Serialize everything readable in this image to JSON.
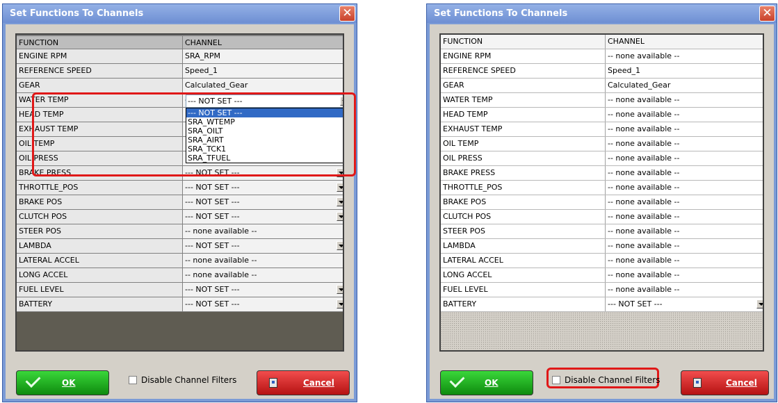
{
  "dialog_left": {
    "title": "Set Functions To Channels",
    "header": {
      "function": "FUNCTION",
      "channel": "CHANNEL"
    },
    "rows": [
      {
        "function": "ENGINE RPM",
        "channel": "SRA_RPM",
        "dropdown": false
      },
      {
        "function": "REFERENCE SPEED",
        "channel": "Speed_1",
        "dropdown": false
      },
      {
        "function": "GEAR",
        "channel": "Calculated_Gear",
        "dropdown": false
      },
      {
        "function": "WATER TEMP",
        "channel": "--- NOT SET ---",
        "dropdown": true
      },
      {
        "function": "HEAD TEMP",
        "channel": "",
        "dropdown": false
      },
      {
        "function": "EXHAUST TEMP",
        "channel": "",
        "dropdown": false
      },
      {
        "function": "OIL TEMP",
        "channel": "",
        "dropdown": false
      },
      {
        "function": "OIL  PRESS",
        "channel": "",
        "dropdown": false
      },
      {
        "function": "BRAKE PRESS",
        "channel": "--- NOT SET ---",
        "dropdown": true
      },
      {
        "function": "THROTTLE_POS",
        "channel": "--- NOT SET ---",
        "dropdown": true
      },
      {
        "function": "BRAKE POS",
        "channel": "--- NOT SET ---",
        "dropdown": true
      },
      {
        "function": "CLUTCH POS",
        "channel": "--- NOT SET ---",
        "dropdown": true
      },
      {
        "function": "STEER POS",
        "channel": "-- none available --",
        "dropdown": false
      },
      {
        "function": "LAMBDA",
        "channel": "--- NOT SET ---",
        "dropdown": true
      },
      {
        "function": "LATERAL  ACCEL",
        "channel": "-- none available --",
        "dropdown": false
      },
      {
        "function": "LONG ACCEL",
        "channel": "-- none available --",
        "dropdown": false
      },
      {
        "function": "FUEL LEVEL",
        "channel": "--- NOT SET ---",
        "dropdown": true
      },
      {
        "function": "BATTERY",
        "channel": "--- NOT SET ---",
        "dropdown": true
      }
    ],
    "combo_value": "--- NOT SET ---",
    "dropdown_options": [
      "--- NOT SET ---",
      "SRA_WTEMP",
      "SRA_OILT",
      "SRA_AIRT",
      "SRA_TCK1",
      "SRA_TFUEL"
    ],
    "selected_option": "--- NOT SET ---",
    "ok_label": "OK",
    "cancel_label": "Cancel",
    "filter_label": "Disable Channel Filters",
    "filter_checked": false,
    "close_glyph": "✕"
  },
  "dialog_right": {
    "title": "Set Functions To Channels",
    "header": {
      "function": "FUNCTION",
      "channel": "CHANNEL"
    },
    "rows": [
      {
        "function": "ENGINE RPM",
        "channel": "-- none available --",
        "dropdown": false
      },
      {
        "function": "REFERENCE SPEED",
        "channel": "Speed_1",
        "dropdown": false
      },
      {
        "function": "GEAR",
        "channel": "Calculated_Gear",
        "dropdown": false
      },
      {
        "function": "WATER TEMP",
        "channel": "-- none available --",
        "dropdown": false
      },
      {
        "function": "HEAD TEMP",
        "channel": "-- none available --",
        "dropdown": false
      },
      {
        "function": "EXHAUST TEMP",
        "channel": "-- none available --",
        "dropdown": false
      },
      {
        "function": "OIL TEMP",
        "channel": "-- none available --",
        "dropdown": false
      },
      {
        "function": "OIL  PRESS",
        "channel": "-- none available --",
        "dropdown": false
      },
      {
        "function": "BRAKE PRESS",
        "channel": "-- none available --",
        "dropdown": false
      },
      {
        "function": "THROTTLE_POS",
        "channel": "-- none available --",
        "dropdown": false
      },
      {
        "function": "BRAKE POS",
        "channel": "-- none available --",
        "dropdown": false
      },
      {
        "function": "CLUTCH  POS",
        "channel": "-- none available --",
        "dropdown": false
      },
      {
        "function": "STEER POS",
        "channel": "-- none available --",
        "dropdown": false
      },
      {
        "function": "LAMBDA",
        "channel": "-- none available --",
        "dropdown": false
      },
      {
        "function": "LATERAL  ACCEL",
        "channel": "-- none available --",
        "dropdown": false
      },
      {
        "function": "LONG ACCEL",
        "channel": "-- none available --",
        "dropdown": false
      },
      {
        "function": "FUEL LEVEL",
        "channel": "-- none available --",
        "dropdown": false
      },
      {
        "function": "BATTERY",
        "channel": "--- NOT SET ---",
        "dropdown": true
      }
    ],
    "ok_label": "OK",
    "cancel_label": "Cancel",
    "filter_label": "Disable Channel Filters",
    "filter_checked": false,
    "close_glyph": "✕"
  },
  "colors": {
    "titlebar": "#7b9bd6",
    "highlight": "#e01818",
    "ok_green": "#1ea81e",
    "cancel_red": "#d42020",
    "selection_blue": "#316ac5"
  }
}
